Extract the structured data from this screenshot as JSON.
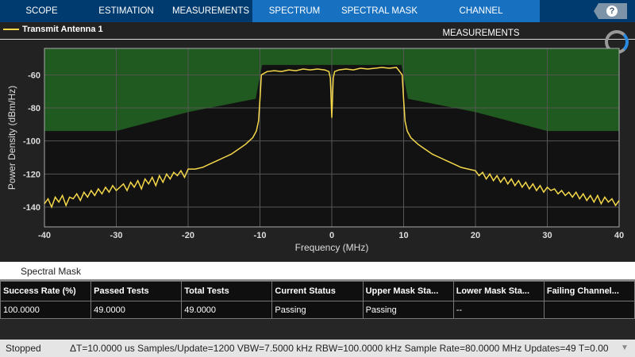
{
  "tabs": [
    "SCOPE",
    "ESTIMATION",
    "MEASUREMENTS",
    "SPECTRUM",
    "SPECTRAL MASK",
    "CHANNEL MEASUREMENTS"
  ],
  "help_label": "?",
  "legend": "Transmit Antenna 1",
  "colors": {
    "trace": "#f5d84a",
    "mask": "#215a21",
    "plot_bg": "#121212",
    "tab_bg": "#003b6f",
    "tab_active": "#1771c0"
  },
  "chart_data": {
    "type": "line",
    "xlabel": "Frequency (MHz)",
    "ylabel": "Power Density (dBm/Hz)",
    "xlim": [
      -40,
      40
    ],
    "ylim": [
      -152,
      -44
    ],
    "xticks": [
      -40,
      -30,
      -20,
      -10,
      0,
      10,
      20,
      30,
      40
    ],
    "yticks": [
      -60,
      -80,
      -100,
      -120,
      -140
    ],
    "grid": true,
    "series": [
      {
        "name": "Transmit Antenna 1",
        "x": [
          -40,
          -39.5,
          -39,
          -38.5,
          -38,
          -37.5,
          -37,
          -36.5,
          -36,
          -35.5,
          -35,
          -34.5,
          -34,
          -33.5,
          -33,
          -32.5,
          -32,
          -31.5,
          -31,
          -30.5,
          -30,
          -29.5,
          -29,
          -28.5,
          -28,
          -27.5,
          -27,
          -26.5,
          -26,
          -25.5,
          -25,
          -24.5,
          -24,
          -23.5,
          -23,
          -22.5,
          -22,
          -21.5,
          -21,
          -20.5,
          -20,
          -19,
          -18,
          -17,
          -16,
          -15,
          -14,
          -13,
          -12,
          -11,
          -10.5,
          -10.2,
          -10,
          -9.8,
          -9,
          -8,
          -7,
          -6,
          -5,
          -4,
          -3,
          -2,
          -1,
          -0.4,
          -0.2,
          0,
          0.2,
          0.4,
          1,
          2,
          3,
          4,
          5,
          6,
          7,
          8,
          9,
          9.8,
          10,
          10.2,
          10.5,
          11,
          12,
          13,
          14,
          15,
          16,
          17,
          18,
          19,
          20,
          20.5,
          21,
          21.5,
          22,
          22.5,
          23,
          23.5,
          24,
          24.5,
          25,
          25.5,
          26,
          26.5,
          27,
          27.5,
          28,
          28.5,
          29,
          29.5,
          30,
          30.5,
          31,
          31.5,
          32,
          32.5,
          33,
          33.5,
          34,
          34.5,
          35,
          35.5,
          36,
          36.5,
          37,
          37.5,
          38,
          38.5,
          39,
          39.5,
          40
        ],
        "y": [
          -138,
          -135,
          -140,
          -134,
          -137,
          -133,
          -139,
          -134,
          -135,
          -132,
          -136,
          -131,
          -134,
          -130,
          -133,
          -129,
          -132,
          -128,
          -131,
          -127,
          -130,
          -128,
          -126,
          -130,
          -125,
          -128,
          -124,
          -129,
          -123,
          -126,
          -122,
          -127,
          -121,
          -125,
          -120,
          -123,
          -119,
          -121,
          -118,
          -122,
          -117,
          -117,
          -116,
          -114,
          -112,
          -110,
          -108,
          -105,
          -102,
          -98,
          -94,
          -88,
          -75,
          -60,
          -58,
          -57.5,
          -58,
          -57,
          -57.5,
          -56.5,
          -57,
          -56.5,
          -57,
          -58,
          -62,
          -86,
          -62,
          -58,
          -57,
          -56.5,
          -57,
          -56,
          -56.5,
          -56,
          -55.5,
          -56,
          -55.5,
          -60,
          -75,
          -88,
          -94,
          -98,
          -102,
          -105,
          -108,
          -110,
          -112,
          -114,
          -116,
          -117,
          -118,
          -121,
          -119,
          -123,
          -120,
          -124,
          -121,
          -125,
          -122,
          -126,
          -123,
          -127,
          -124,
          -128,
          -125,
          -129,
          -126,
          -130,
          -127,
          -131,
          -128,
          -130,
          -129,
          -132,
          -130,
          -133,
          -131,
          -134,
          -131,
          -135,
          -132,
          -136,
          -133,
          -137,
          -133,
          -138,
          -134,
          -137,
          -135,
          -139,
          -136
        ]
      },
      {
        "name": "Spectral Mask",
        "x": [
          -40,
          -30,
          -20,
          -10.6,
          -9.7,
          9.7,
          10.6,
          20,
          30,
          40
        ],
        "y": [
          -94,
          -94,
          -82.5,
          -74.5,
          -54,
          -54,
          -74.5,
          -82.5,
          -94,
          -94
        ]
      }
    ]
  },
  "panel_title": "Spectral Mask",
  "table": {
    "headers": [
      "Success Rate (%)",
      "Passed Tests",
      "Total Tests",
      "Current Status",
      "Upper Mask Sta...",
      "Lower Mask Sta...",
      "Failing Channel..."
    ],
    "rows": [
      [
        "100.0000",
        "49.0000",
        "49.0000",
        "Passing",
        "Passing",
        "--",
        ""
      ]
    ]
  },
  "status": {
    "state": "Stopped",
    "info": "ΔT=10.0000 us  Samples/Update=1200  VBW=7.5000 kHz  RBW=100.0000 kHz  Sample Rate=80.0000 MHz  Updates=49  T=0.00"
  }
}
